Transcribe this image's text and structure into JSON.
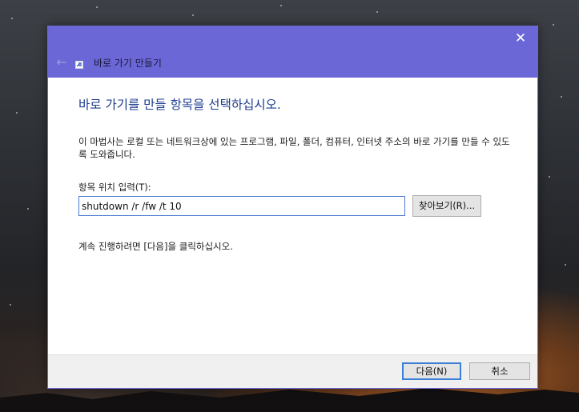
{
  "window": {
    "title": "바로 가기 만들기",
    "close_glyph": "✕",
    "back_glyph": "←"
  },
  "main": {
    "heading": "바로 가기를 만들 항목을 선택하십시오.",
    "description": "이 마법사는 로컬 또는 네트워크상에 있는 프로그램, 파일, 폴더, 컴퓨터, 인터넷 주소의 바로 가기를 만들 수 있도록 도와줍니다.",
    "location_label": "항목 위치 입력(T):",
    "location_value": "shutdown /r /fw /t 10",
    "browse_label": "찾아보기(R)...",
    "continue_text": "계속 진행하려면 [다음]을 클릭하십시오."
  },
  "footer": {
    "next_label": "다음(N)",
    "cancel_label": "취소"
  },
  "colors": {
    "titlebar": "#6b67d6",
    "heading": "#1e3d8f",
    "focus_border": "#3c7fd8"
  }
}
